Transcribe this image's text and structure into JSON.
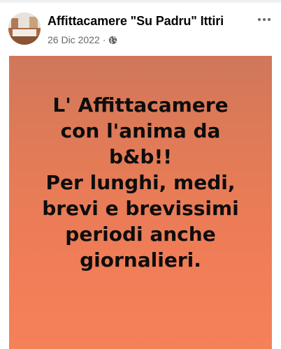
{
  "post": {
    "author": "Affittacamere \"Su Padru\" Ittiri",
    "date": "26 Dic 2022",
    "separator": "·",
    "privacy_icon": "globe-icon",
    "more_icon": "more-options-icon",
    "background_color": "#f07d57",
    "text_lines": [
      "L' Affittacamere",
      "con l'anima da",
      "b&b!!",
      "Per lunghi, medi,",
      "brevi e brevissimi",
      "periodi anche",
      "giornalieri."
    ]
  }
}
